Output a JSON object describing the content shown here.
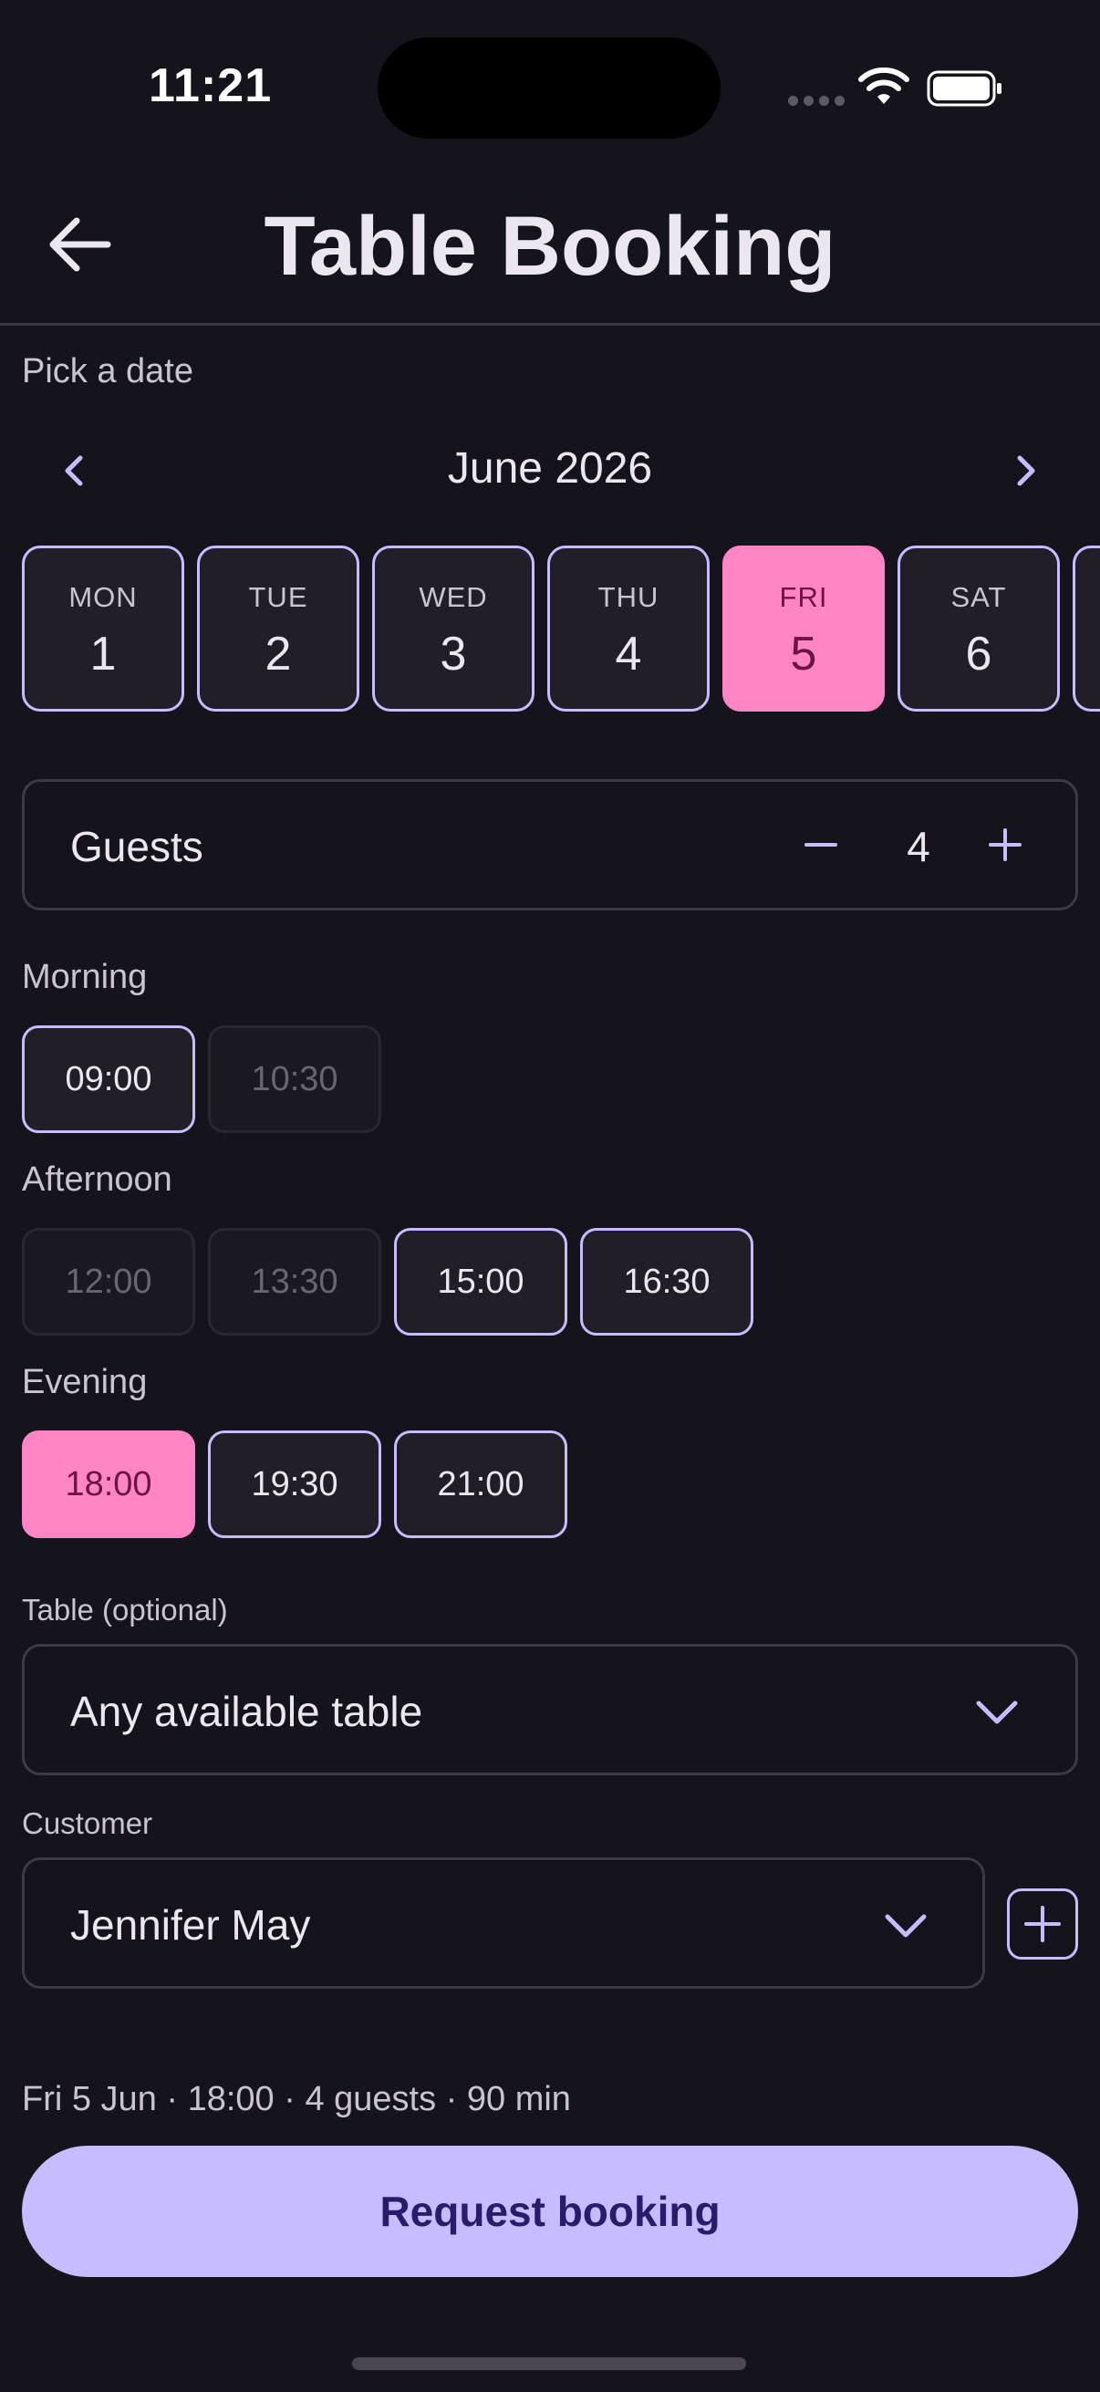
{
  "status_bar": {
    "time": "11:21"
  },
  "header": {
    "title": "Table Booking",
    "back_icon": "arrow-left-icon"
  },
  "date_picker": {
    "label": "Pick a date",
    "month": "June 2026",
    "days": [
      {
        "dow": "MON",
        "num": "1",
        "selected": false
      },
      {
        "dow": "TUE",
        "num": "2",
        "selected": false
      },
      {
        "dow": "WED",
        "num": "3",
        "selected": false
      },
      {
        "dow": "THU",
        "num": "4",
        "selected": false
      },
      {
        "dow": "FRI",
        "num": "5",
        "selected": true
      },
      {
        "dow": "SAT",
        "num": "6",
        "selected": false
      }
    ]
  },
  "guests": {
    "label": "Guests",
    "count": "4",
    "minus": "−",
    "plus": "+"
  },
  "time_slots": {
    "morning": {
      "label": "Morning",
      "slots": [
        {
          "time": "09:00",
          "state": "available"
        },
        {
          "time": "10:30",
          "state": "disabled"
        }
      ]
    },
    "afternoon": {
      "label": "Afternoon",
      "slots": [
        {
          "time": "12:00",
          "state": "disabled"
        },
        {
          "time": "13:30",
          "state": "disabled"
        },
        {
          "time": "15:00",
          "state": "available"
        },
        {
          "time": "16:30",
          "state": "available"
        }
      ]
    },
    "evening": {
      "label": "Evening",
      "slots": [
        {
          "time": "18:00",
          "state": "selected"
        },
        {
          "time": "19:30",
          "state": "available"
        },
        {
          "time": "21:00",
          "state": "available"
        }
      ]
    }
  },
  "table": {
    "label": "Table (optional)",
    "value": "Any available table"
  },
  "customer": {
    "label": "Customer",
    "value": "Jennifer May"
  },
  "summary": "Fri 5 Jun · 18:00 · 4 guests · 90 min",
  "cta": {
    "label": "Request booking"
  },
  "colors": {
    "background": "#15131b",
    "accent": "#c6bcff",
    "selected": "#ff85c4",
    "selected_text": "#6d1447"
  }
}
